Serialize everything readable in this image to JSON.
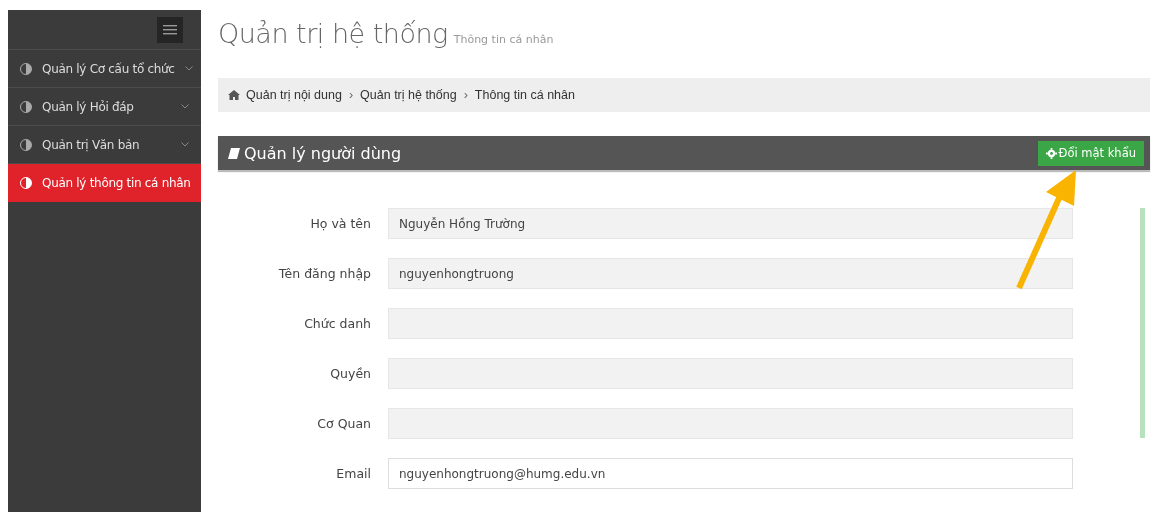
{
  "sidebar": {
    "items": [
      {
        "label": "Quản lý Cơ cấu tổ chức",
        "expandable": true,
        "selected": false
      },
      {
        "label": "Quản lý Hỏi đáp",
        "expandable": true,
        "selected": false
      },
      {
        "label": "Quản trị Văn bản",
        "expandable": true,
        "selected": false
      },
      {
        "label": "Quản lý thông tin cá nhân",
        "expandable": false,
        "selected": true
      }
    ]
  },
  "page": {
    "title": "Quản trị hệ thống",
    "subtitle": "Thông tin cá nhân"
  },
  "breadcrumb": [
    "Quản trị nội dung",
    "Quản trị hệ thống",
    "Thông tin cá nhân"
  ],
  "breadcrumb_separator": "›",
  "panel": {
    "title": "Quản lý người dùng",
    "button": "Đổi mật khẩu",
    "fields": [
      {
        "label": "Họ và tên",
        "value": "Nguyễn Hồng Trường",
        "disabled": true
      },
      {
        "label": "Tên đăng nhập",
        "value": "nguyenhongtruong",
        "disabled": true
      },
      {
        "label": "Chức danh",
        "disabled": true
      },
      {
        "label": "Quyền",
        "disabled": true
      },
      {
        "label": "Cơ Quan",
        "disabled": true
      },
      {
        "label": "Email",
        "value": "nguyenhongtruong@humg.edu.vn",
        "disabled": false
      }
    ]
  }
}
